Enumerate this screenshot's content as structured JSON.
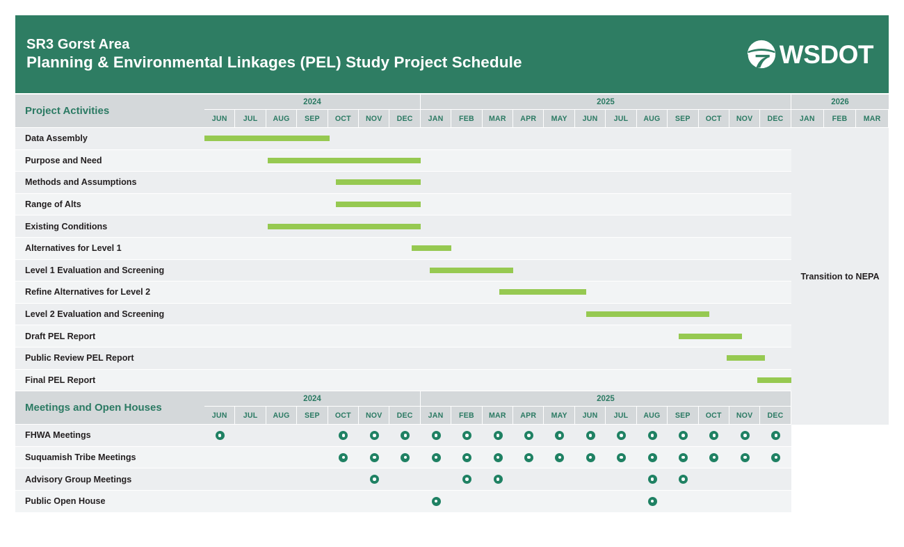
{
  "header": {
    "title_line1": "SR3 Gorst Area",
    "title_line2": "Planning & Environmental Linkages (PEL) Study Project Schedule",
    "brand_word": "WSDOT",
    "brand_icon": "wsdot-circle-logo-icon",
    "background_color": "#2e7d63"
  },
  "colors": {
    "banner_green": "#2e7d63",
    "header_cell_gray": "#d4d8da",
    "row_gray": "#eceef0",
    "row_gray_alt": "#f2f4f5",
    "bar_green": "#96c951",
    "dot_green": "#1f8163",
    "label_green_text": "#2b7a63",
    "body_text": "#231f20"
  },
  "timeline": {
    "years": [
      {
        "label": "2024",
        "months": [
          "JUN",
          "JUL",
          "AUG",
          "SEP",
          "OCT",
          "NOV",
          "DEC"
        ]
      },
      {
        "label": "2025",
        "months": [
          "JAN",
          "FEB",
          "MAR",
          "APR",
          "MAY",
          "JUN",
          "JUL",
          "AUG",
          "SEP",
          "OCT",
          "NOV",
          "DEC"
        ]
      }
    ],
    "trailing_year": {
      "label": "2026",
      "months": [
        "JAN",
        "FEB",
        "MAR"
      ]
    },
    "month_keys": [
      "2024-JUN",
      "2024-JUL",
      "2024-AUG",
      "2024-SEP",
      "2024-OCT",
      "2024-NOV",
      "2024-DEC",
      "2025-JAN",
      "2025-FEB",
      "2025-MAR",
      "2025-APR",
      "2025-MAY",
      "2025-JUN",
      "2025-JUL",
      "2025-AUG",
      "2025-SEP",
      "2025-OCT",
      "2025-NOV",
      "2025-DEC"
    ]
  },
  "sections": [
    {
      "title": "Project Activities",
      "type": "gantt",
      "rows": [
        {
          "label": "Data Assembly",
          "start_month": "2024-JUN",
          "end_month": "2024-SEP",
          "start_index": 0.0,
          "span": 4.05
        },
        {
          "label": "Purpose and Need",
          "start_month": "2024-AUG",
          "end_month": "2024-DEC",
          "start_index": 2.05,
          "span": 4.95
        },
        {
          "label": "Methods and Assumptions",
          "start_month": "2024-OCT",
          "end_month": "2024-DEC",
          "start_index": 4.25,
          "span": 2.75
        },
        {
          "label": "Range of Alts",
          "start_month": "2024-OCT",
          "end_month": "2024-DEC",
          "start_index": 4.25,
          "span": 2.75
        },
        {
          "label": "Existing Conditions",
          "start_month": "2024-AUG",
          "end_month": "2024-DEC",
          "start_index": 2.05,
          "span": 4.95
        },
        {
          "label": "Alternatives for Level 1",
          "start_month": "2024-DEC",
          "end_month": "2025-JAN",
          "start_index": 6.7,
          "span": 1.3
        },
        {
          "label": "Level 1 Evaluation and Screening",
          "start_month": "2025-JAN",
          "end_month": "2025-MAR",
          "start_index": 7.3,
          "span": 2.7
        },
        {
          "label": "Refine Alternatives for Level 2",
          "start_month": "2025-MAR",
          "end_month": "2025-JUN",
          "start_index": 9.55,
          "span": 2.8
        },
        {
          "label": "Level 2 Evaluation and Screening",
          "start_month": "2025-JUL",
          "end_month": "2025-OCT",
          "start_index": 12.35,
          "span": 4.0
        },
        {
          "label": "Draft PEL Report",
          "start_month": "2025-AUG",
          "end_month": "2025-NOV",
          "start_index": 15.35,
          "span": 2.05
        },
        {
          "label": "Public Review PEL Report",
          "start_month": "2025-OCT",
          "end_month": "2025-NOV",
          "start_index": 16.9,
          "span": 1.25
        },
        {
          "label": "Final PEL Report",
          "start_month": "2025-NOV",
          "end_month": "2025-DEC",
          "start_index": 17.9,
          "span": 1.7
        }
      ]
    },
    {
      "title": "Meetings and Open Houses",
      "type": "milestones",
      "rows": [
        {
          "label": "FHWA Meetings",
          "months": [
            "2024-JUN",
            "2024-OCT",
            "2024-NOV",
            "2024-DEC",
            "2025-JAN",
            "2025-FEB",
            "2025-MAR",
            "2025-APR",
            "2025-MAY",
            "2025-JUN",
            "2025-JUL",
            "2025-AUG",
            "2025-SEP",
            "2025-OCT",
            "2025-NOV",
            "2025-DEC"
          ]
        },
        {
          "label": "Suquamish Tribe Meetings",
          "months": [
            "2024-OCT",
            "2024-NOV",
            "2024-DEC",
            "2025-JAN",
            "2025-FEB",
            "2025-MAR",
            "2025-APR",
            "2025-MAY",
            "2025-JUN",
            "2025-JUL",
            "2025-AUG",
            "2025-SEP",
            "2025-OCT",
            "2025-NOV",
            "2025-DEC"
          ]
        },
        {
          "label": "Advisory Group Meetings",
          "months": [
            "2024-NOV",
            "2025-FEB",
            "2025-MAR",
            "2025-AUG",
            "2025-SEP"
          ]
        },
        {
          "label": "Public Open House",
          "months": [
            "2025-JAN",
            "2025-AUG"
          ]
        }
      ]
    }
  ],
  "nepa": {
    "label": "Transition to NEPA"
  }
}
